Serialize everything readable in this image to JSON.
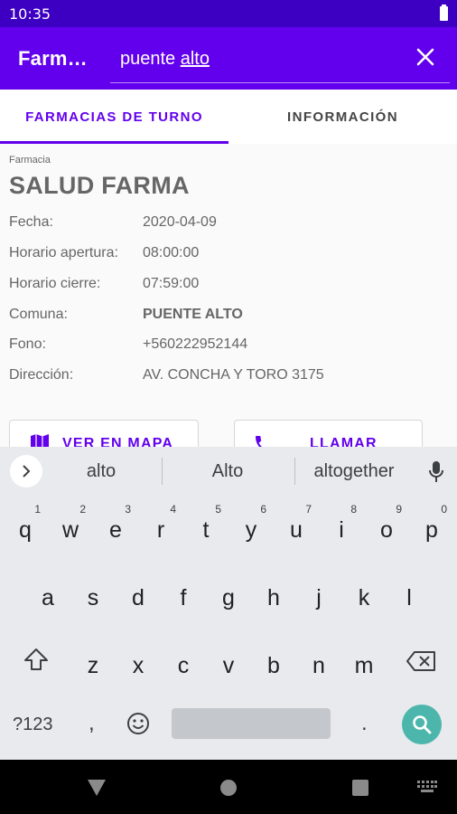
{
  "status_bar": {
    "time": "10:35"
  },
  "app_bar": {
    "title": "Farm…",
    "search_prefix": "puente ",
    "search_underlined": "alto"
  },
  "tabs": [
    {
      "label": "FARMACIAS DE TURNO",
      "active": true
    },
    {
      "label": "INFORMACIÓN",
      "active": false
    }
  ],
  "pharmacy": {
    "caption": "Farmacia",
    "name": "SALUD FARMA",
    "fields": [
      {
        "label": "Fecha:",
        "value": "2020-04-09"
      },
      {
        "label": "Horario apertura:",
        "value": "08:00:00"
      },
      {
        "label": "Horario cierre:",
        "value": "07:59:00"
      },
      {
        "label": "Comuna:",
        "value": "PUENTE ALTO"
      },
      {
        "label": "Fono:",
        "value": "+560222952144"
      },
      {
        "label": "Dirección:",
        "value": "AV. CONCHA Y TORO 3175"
      }
    ],
    "map_button": "VER EN MAPA",
    "call_button": "LLAMAR"
  },
  "keyboard": {
    "suggestions": [
      "alto",
      "Alto",
      "altogether"
    ],
    "row1": [
      {
        "ch": "q",
        "num": "1"
      },
      {
        "ch": "w",
        "num": "2"
      },
      {
        "ch": "e",
        "num": "3"
      },
      {
        "ch": "r",
        "num": "4"
      },
      {
        "ch": "t",
        "num": "5"
      },
      {
        "ch": "y",
        "num": "6"
      },
      {
        "ch": "u",
        "num": "7"
      },
      {
        "ch": "i",
        "num": "8"
      },
      {
        "ch": "o",
        "num": "9"
      },
      {
        "ch": "p",
        "num": "0"
      }
    ],
    "row2": [
      "a",
      "s",
      "d",
      "f",
      "g",
      "h",
      "j",
      "k",
      "l"
    ],
    "row3": [
      "z",
      "x",
      "c",
      "v",
      "b",
      "n",
      "m"
    ],
    "symbols_label": "?123",
    "comma": ",",
    "period": "."
  },
  "colors": {
    "status_bar": "#3d00c2",
    "app_bar": "#6200ee",
    "accent": "#6200ee",
    "search_key": "#4db6ac"
  },
  "icons": [
    "battery-icon",
    "close-icon",
    "map-icon",
    "phone-icon",
    "chevron-right-icon",
    "mic-icon",
    "shift-icon",
    "backspace-icon",
    "emoji-icon",
    "search-icon",
    "back-icon",
    "home-icon",
    "recent-apps-icon",
    "keyboard-icon"
  ]
}
